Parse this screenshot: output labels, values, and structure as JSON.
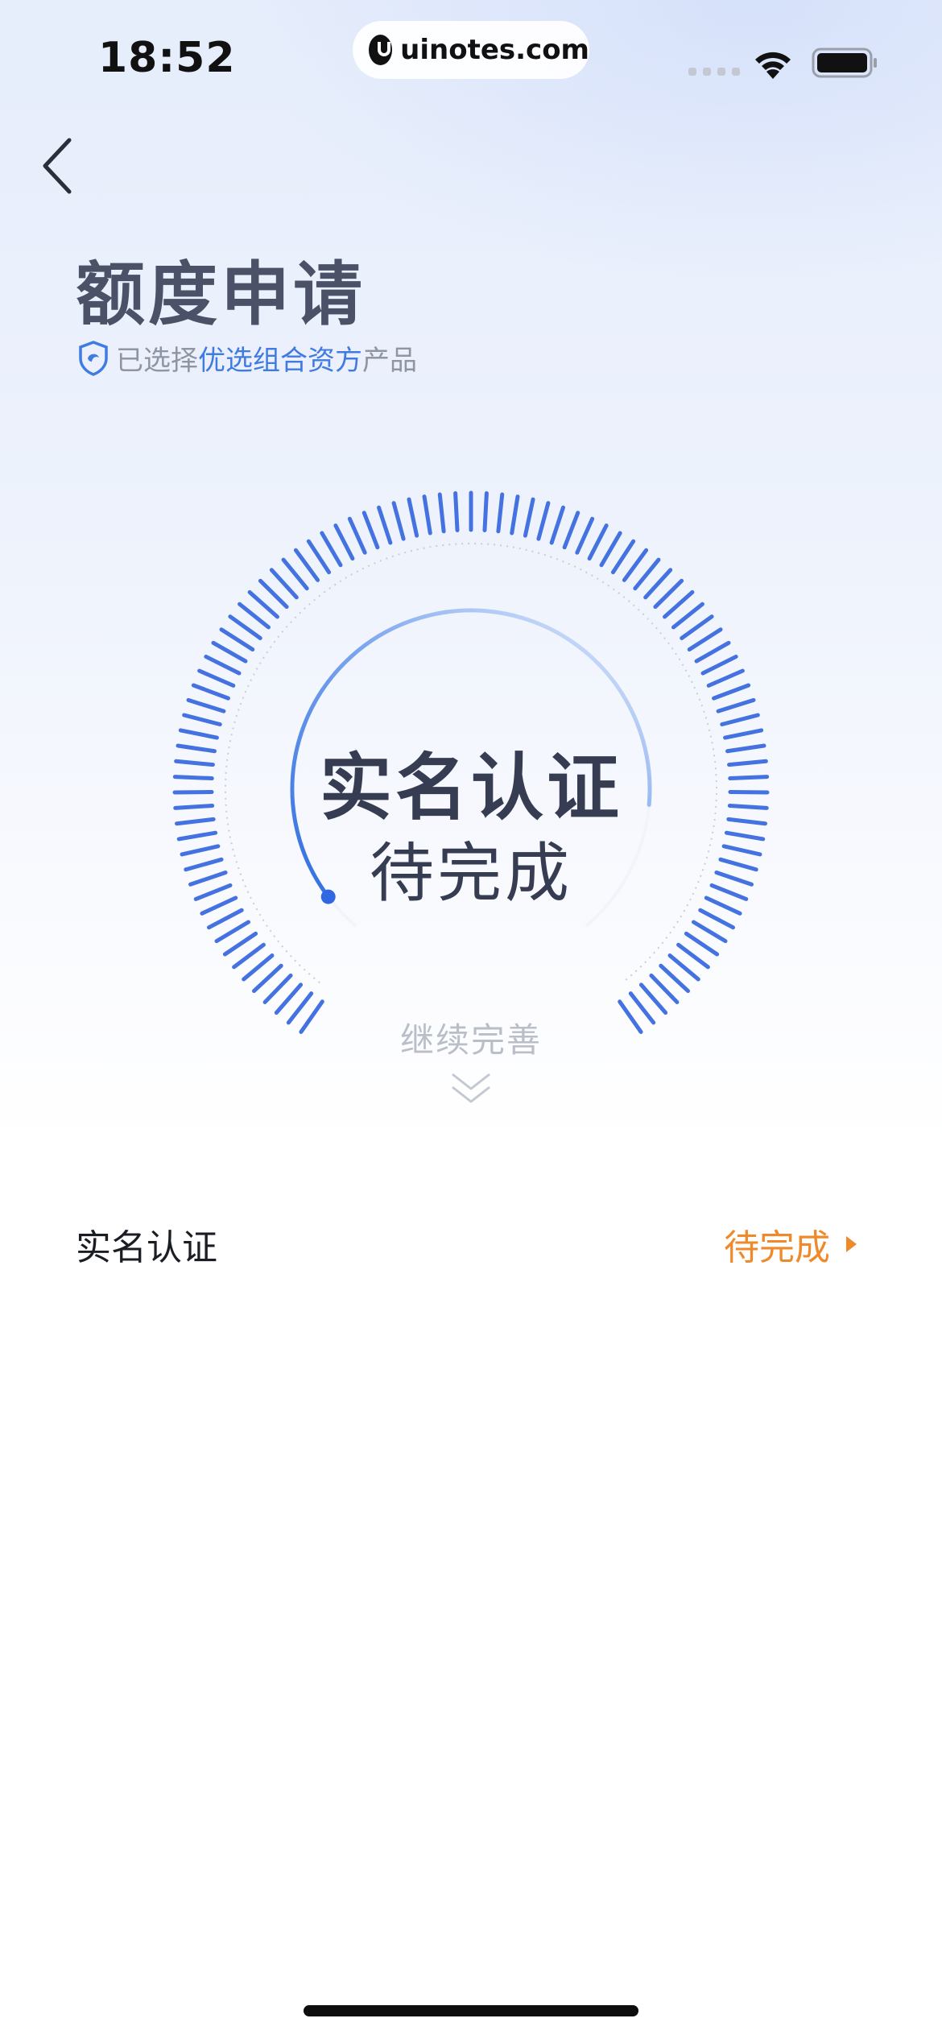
{
  "status_bar": {
    "time": "18:52",
    "url": "uinotes.com"
  },
  "header": {
    "title": "额度申请",
    "subtitle_prefix": "已选择",
    "subtitle_accent": "优选组合资方",
    "subtitle_suffix": "产品"
  },
  "gauge": {
    "title": "实名认证",
    "status": "待完成",
    "continue_label": "继续完善",
    "progress_color": "#3f7be0",
    "tick_color": "#4472e0"
  },
  "list": {
    "items": [
      {
        "label": "实名认证",
        "status": "待完成",
        "status_color": "#ee8a2b"
      }
    ]
  }
}
